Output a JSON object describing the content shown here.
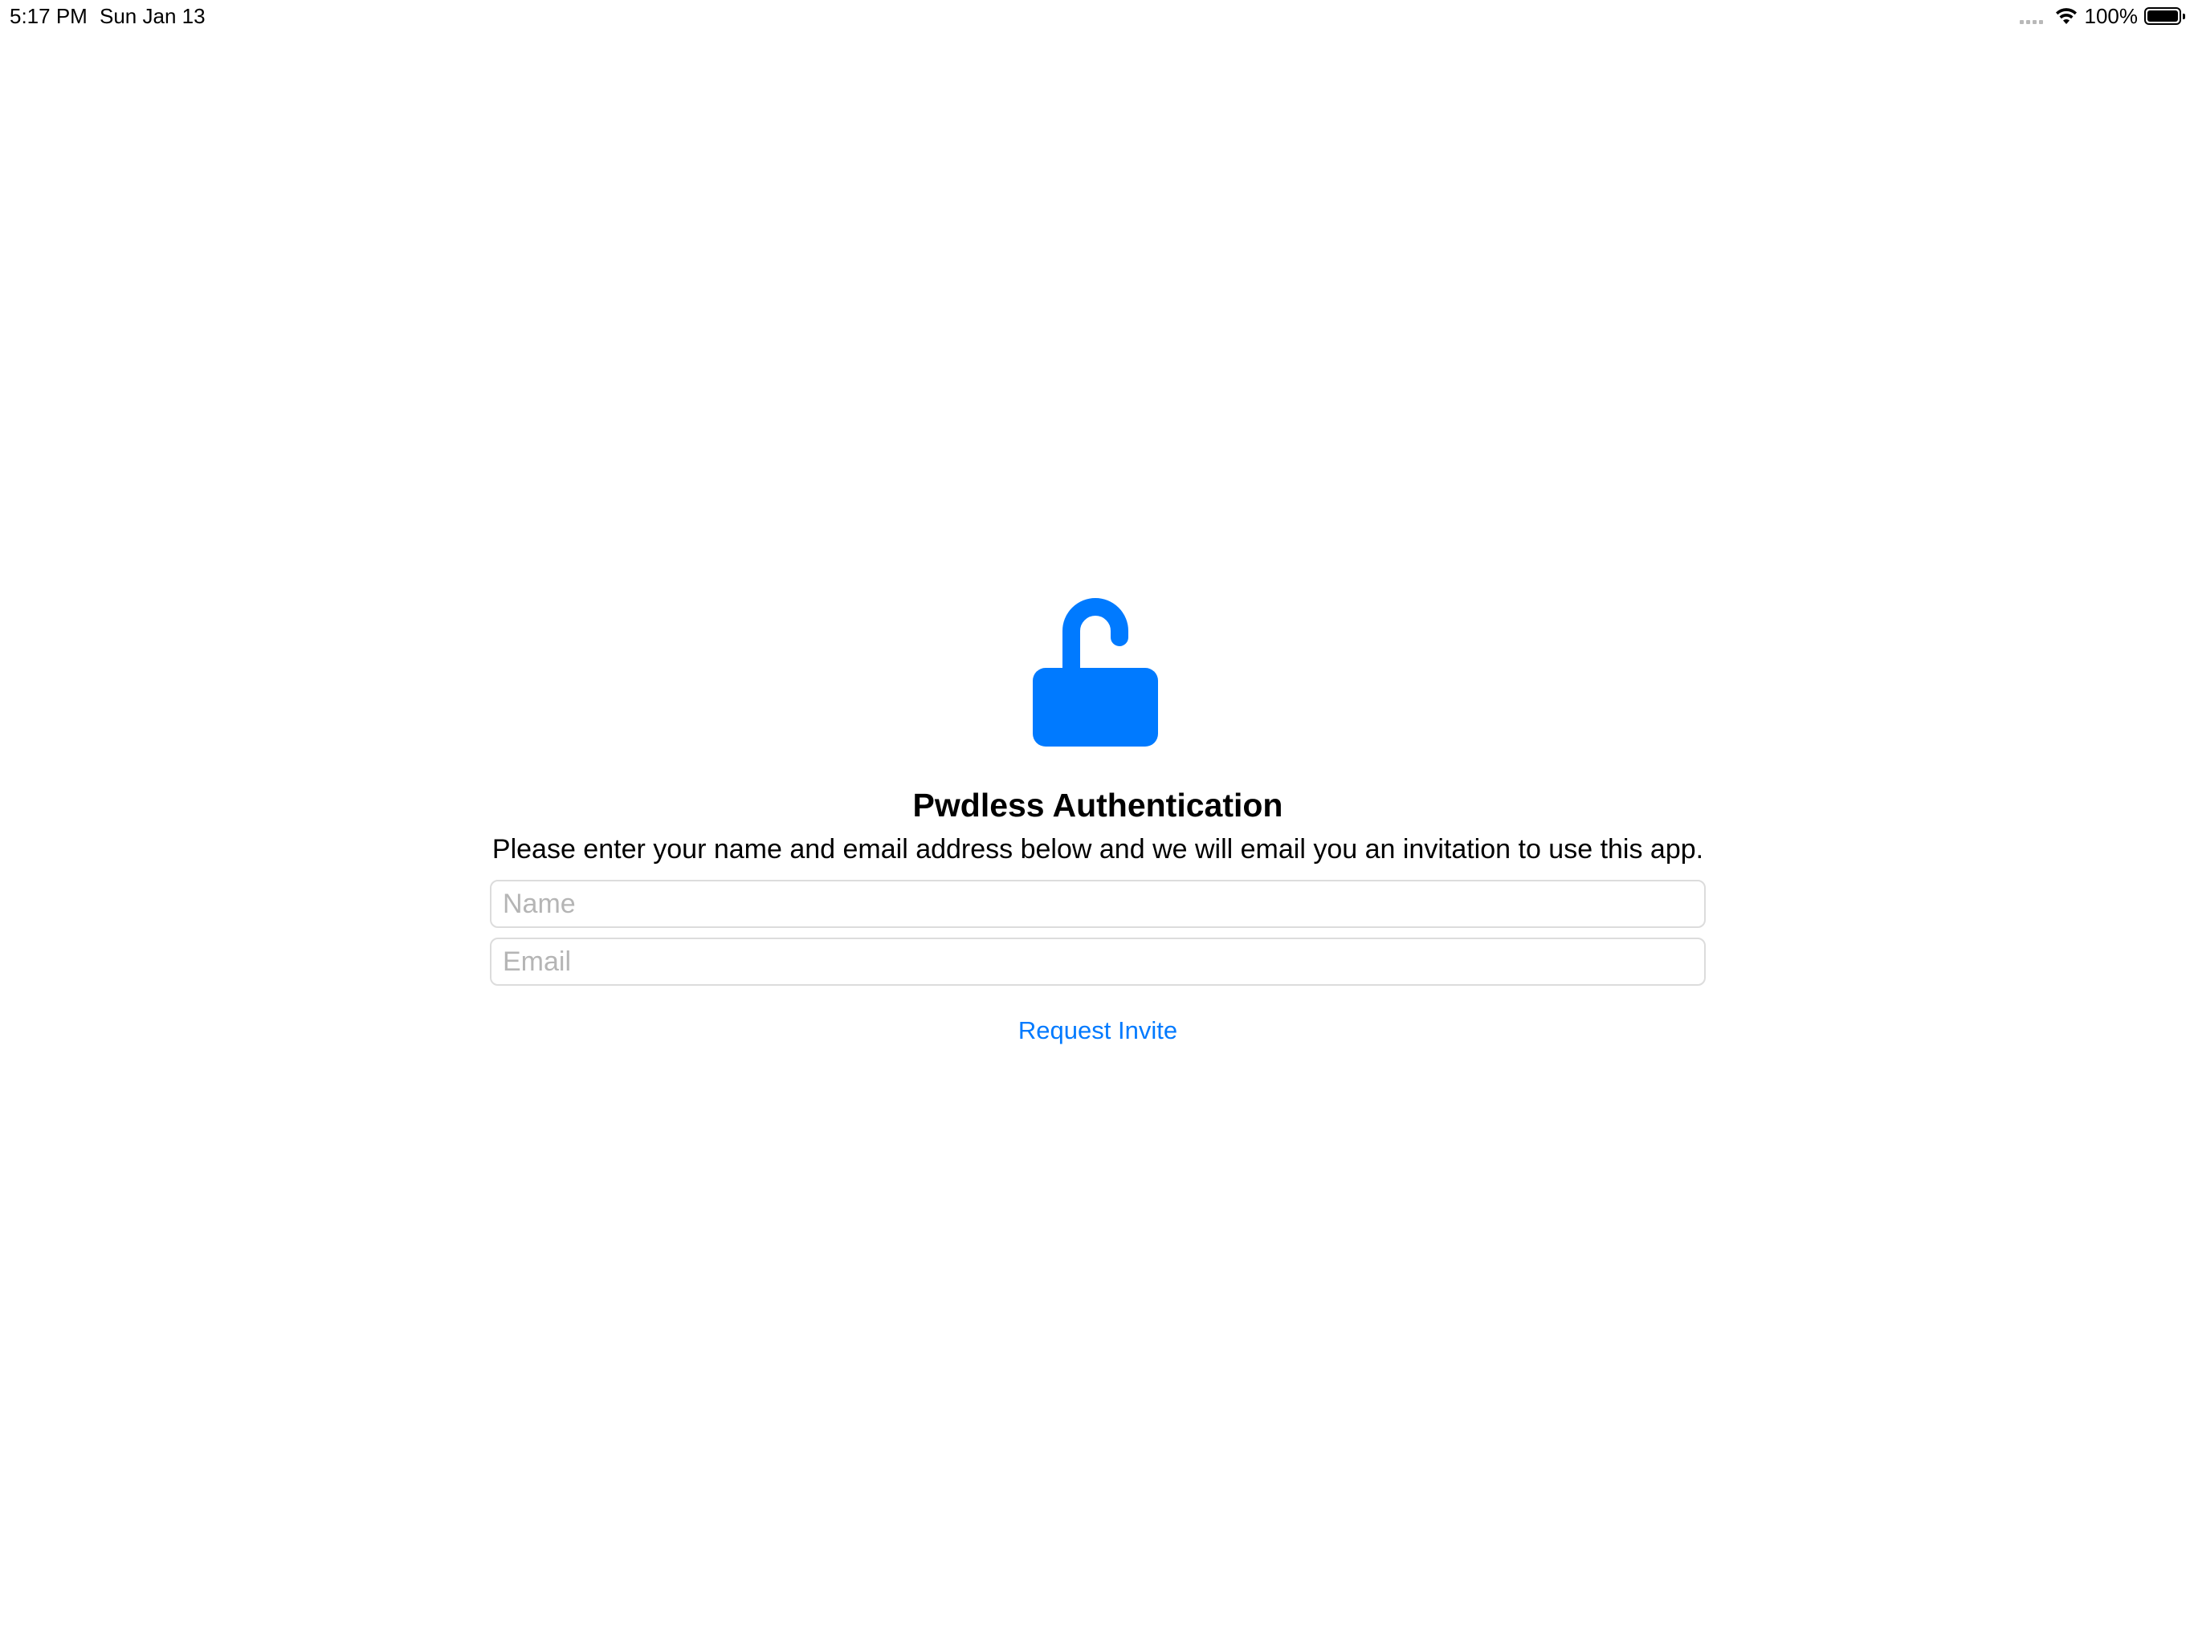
{
  "status_bar": {
    "time": "5:17 PM",
    "date": "Sun Jan 13",
    "battery_percent": "100%",
    "battery_level": 1.0,
    "icons": [
      "signal-icon",
      "wifi-icon",
      "battery-icon"
    ]
  },
  "colors": {
    "accent": "#007aff",
    "text": "#000000",
    "placeholder": "#b5b5b5",
    "field_border": "#dcdcdc",
    "background": "#ffffff"
  },
  "main": {
    "icon": "unlocked-padlock-icon",
    "title": "Pwdless Authentication",
    "description": "Please enter your name and email address below and we will email you an invitation to use this app.",
    "name_field": {
      "placeholder": "Name",
      "value": ""
    },
    "email_field": {
      "placeholder": "Email",
      "value": ""
    },
    "request_button_label": "Request Invite"
  }
}
